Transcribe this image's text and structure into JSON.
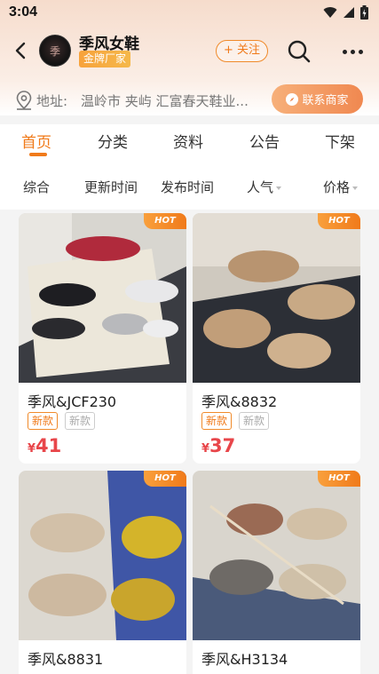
{
  "status_bar": {
    "time": "3:04"
  },
  "shop": {
    "name": "季风女鞋",
    "badge": "金牌厂家",
    "avatar_text": "季"
  },
  "header": {
    "follow_label": "+ 关注"
  },
  "address": {
    "label": "地址:",
    "text": "温岭市 夹屿 汇富春天鞋业...",
    "contact_label": "联系商家"
  },
  "tabs": [
    {
      "label": "首页",
      "active": true
    },
    {
      "label": "分类"
    },
    {
      "label": "资料"
    },
    {
      "label": "公告"
    },
    {
      "label": "下架"
    }
  ],
  "sort": {
    "overall": "综合",
    "updated": "更新时间",
    "published": "发布时间",
    "popularity": "人气",
    "price": "价格"
  },
  "products": [
    {
      "title": "季风&JCF230",
      "badge": "HOT",
      "tags": [
        "新款",
        "新款"
      ],
      "currency": "¥",
      "price": "41"
    },
    {
      "title": "季风&8832",
      "badge": "HOT",
      "tags": [
        "新款",
        "新款"
      ],
      "currency": "¥",
      "price": "37"
    },
    {
      "title": "季风&8831",
      "badge": "HOT"
    },
    {
      "title": "季风&H3134",
      "badge": "HOT"
    }
  ],
  "colors": {
    "accent": "#f07a1a",
    "price": "#e8464a",
    "badge": "#f7a23b"
  }
}
